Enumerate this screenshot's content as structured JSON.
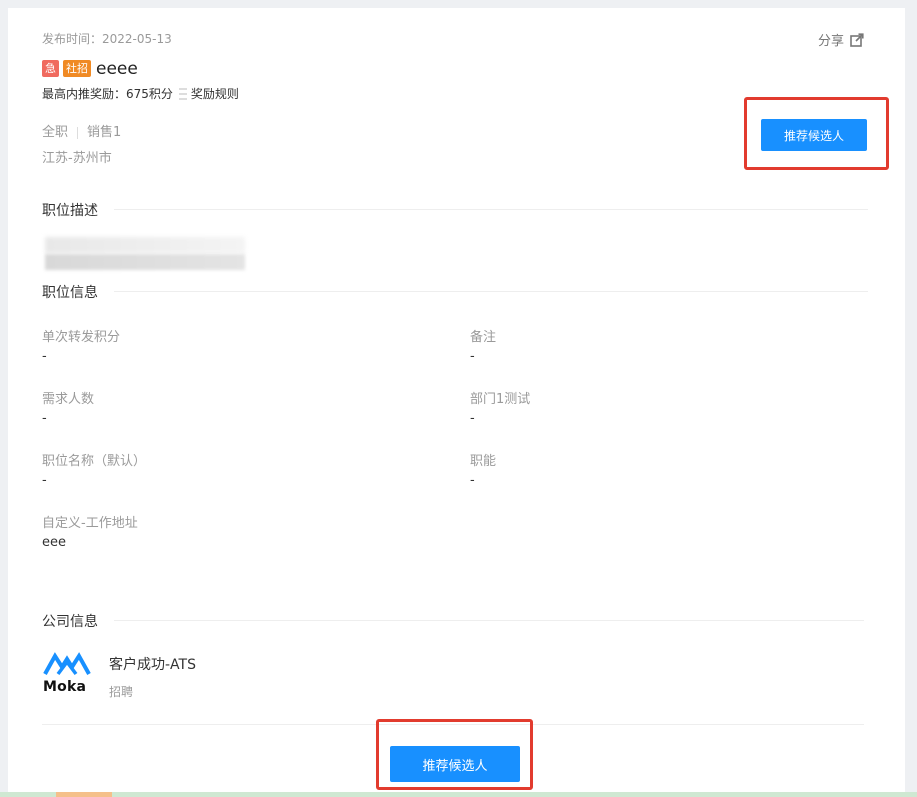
{
  "header": {
    "publish_label": "发布时间：",
    "publish_date": "2022-05-13",
    "share_label": "分享"
  },
  "job": {
    "tag_urgent": "急",
    "tag_type": "社招",
    "title": "eeee",
    "reward_label": "最高内推奖励：",
    "reward_value": "675积分",
    "reward_rules": "奖励规则",
    "employment_type": "全职",
    "department": "销售1",
    "location": "江苏-苏州市"
  },
  "actions": {
    "recommend_top": "推荐候选人",
    "recommend_bottom": "推荐候选人"
  },
  "sections": {
    "description_title": "职位描述",
    "info_title": "职位信息",
    "company_title": "公司信息"
  },
  "fields": [
    {
      "label": "单次转发积分",
      "value": "-"
    },
    {
      "label": "备注",
      "value": "-"
    },
    {
      "label": "需求人数",
      "value": "-"
    },
    {
      "label": "部门1测试",
      "value": "-"
    },
    {
      "label": "职位名称（默认）",
      "value": "-"
    },
    {
      "label": "职能",
      "value": "-"
    },
    {
      "label": "自定义-工作地址",
      "value": "eee"
    }
  ],
  "company": {
    "logo_text": "Moka",
    "name": "客户成功-ATS",
    "sub": "招聘"
  },
  "colors": {
    "primary": "#1890ff",
    "urgent": "#f06a5f",
    "tag_type": "#f08a24",
    "highlight": "#e23b2e"
  },
  "icons": {
    "share": "share-external-icon",
    "reward_rules": "document-lines-icon",
    "company_logo": "moka-logo"
  }
}
